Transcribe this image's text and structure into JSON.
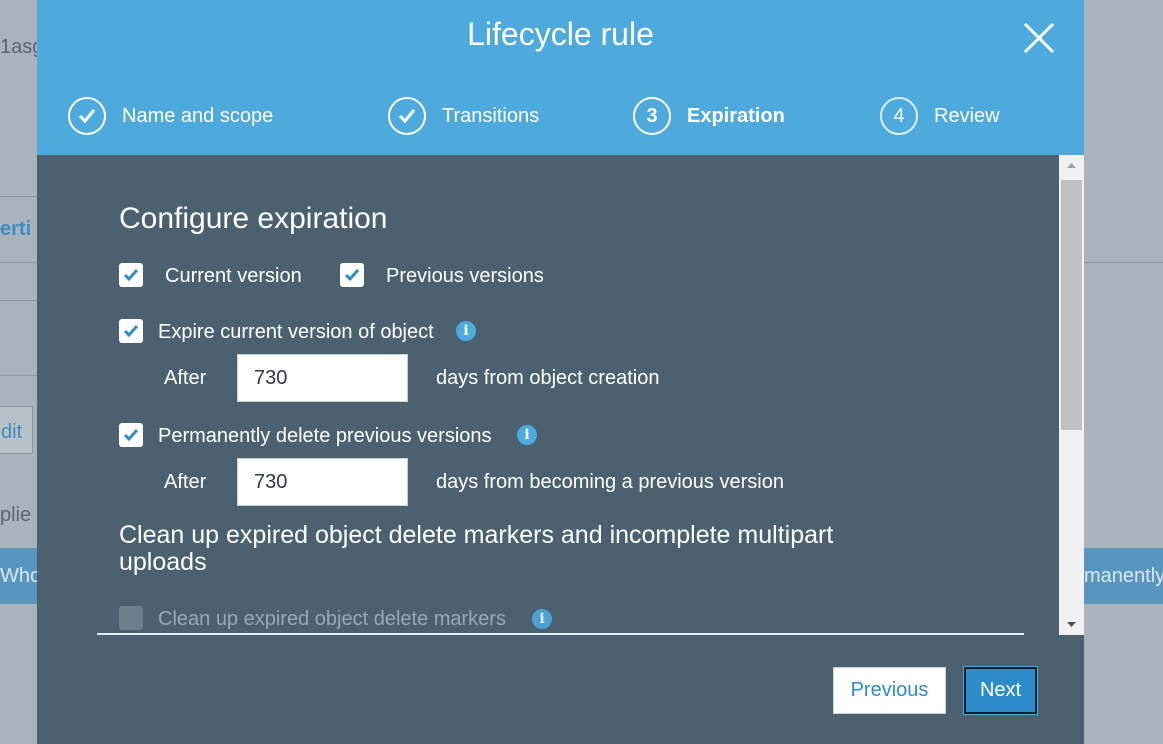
{
  "background": {
    "fragment_top": "1asg",
    "fragment_tab": "erti",
    "fragment_edit": "dit",
    "fragment_applied": "plie",
    "fragment_whole": "Whole",
    "fragment_permanently": "manently"
  },
  "modal": {
    "title": "Lifecycle rule",
    "steps": [
      {
        "num": "1",
        "label": "Name and scope",
        "state": "done"
      },
      {
        "num": "2",
        "label": "Transitions",
        "state": "done"
      },
      {
        "num": "3",
        "label": "Expiration",
        "state": "active"
      },
      {
        "num": "4",
        "label": "Review",
        "state": "upcoming"
      }
    ],
    "section_title": "Configure expiration",
    "current_version_label": "Current version",
    "current_version_checked": true,
    "previous_versions_label": "Previous versions",
    "previous_versions_checked": true,
    "expire_current_label": "Expire current version of object",
    "expire_current_checked": true,
    "expire_after_label": "After",
    "expire_days_value": "730",
    "expire_days_suffix": "days from object creation",
    "delete_previous_label": "Permanently delete previous versions",
    "delete_previous_checked": true,
    "delete_after_label": "After",
    "delete_days_value": "730",
    "delete_days_suffix": "days from becoming a previous version",
    "cleanup_title": "Clean up expired object delete markers and incomplete multipart uploads",
    "cleanup_markers_label": "Clean up expired object delete markers",
    "cleanup_markers_checked": false,
    "previous_button": "Previous",
    "next_button": "Next"
  },
  "colors": {
    "header": "#4ea9dd",
    "body": "#4b6170",
    "accent": "#2e8bc9"
  },
  "icons": {
    "close": "close-icon",
    "check": "checkmark-icon",
    "info": "info-icon"
  }
}
